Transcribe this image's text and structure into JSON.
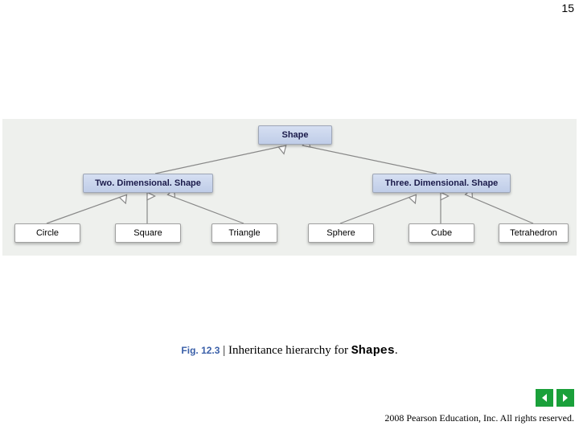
{
  "page_number": "15",
  "diagram": {
    "root": "Shape",
    "level2_left": "Two. Dimensional. Shape",
    "level2_right": "Three. Dimensional. Shape",
    "leaf1": "Circle",
    "leaf2": "Square",
    "leaf3": "Triangle",
    "leaf4": "Sphere",
    "leaf5": "Cube",
    "leaf6": "Tetrahedron"
  },
  "caption": {
    "fig_label": "Fig. 12.3",
    "separator": " | ",
    "text_before": "Inheritance hierarchy for ",
    "code_word": "Shapes",
    "text_after": "."
  },
  "copyright": "  2008 Pearson Education, Inc.  All rights reserved.",
  "nav": {
    "prev_label": "Previous slide",
    "next_label": "Next slide"
  },
  "chart_data": {
    "type": "tree",
    "title": "Inheritance hierarchy for Shapes",
    "nodes": [
      {
        "id": "shape",
        "label": "Shape"
      },
      {
        "id": "two_d",
        "label": "TwoDimensionalShape",
        "parent": "shape"
      },
      {
        "id": "three_d",
        "label": "ThreeDimensionalShape",
        "parent": "shape"
      },
      {
        "id": "circle",
        "label": "Circle",
        "parent": "two_d"
      },
      {
        "id": "square",
        "label": "Square",
        "parent": "two_d"
      },
      {
        "id": "triangle",
        "label": "Triangle",
        "parent": "two_d"
      },
      {
        "id": "sphere",
        "label": "Sphere",
        "parent": "three_d"
      },
      {
        "id": "cube",
        "label": "Cube",
        "parent": "three_d"
      },
      {
        "id": "tetrahedron",
        "label": "Tetrahedron",
        "parent": "three_d"
      }
    ]
  }
}
